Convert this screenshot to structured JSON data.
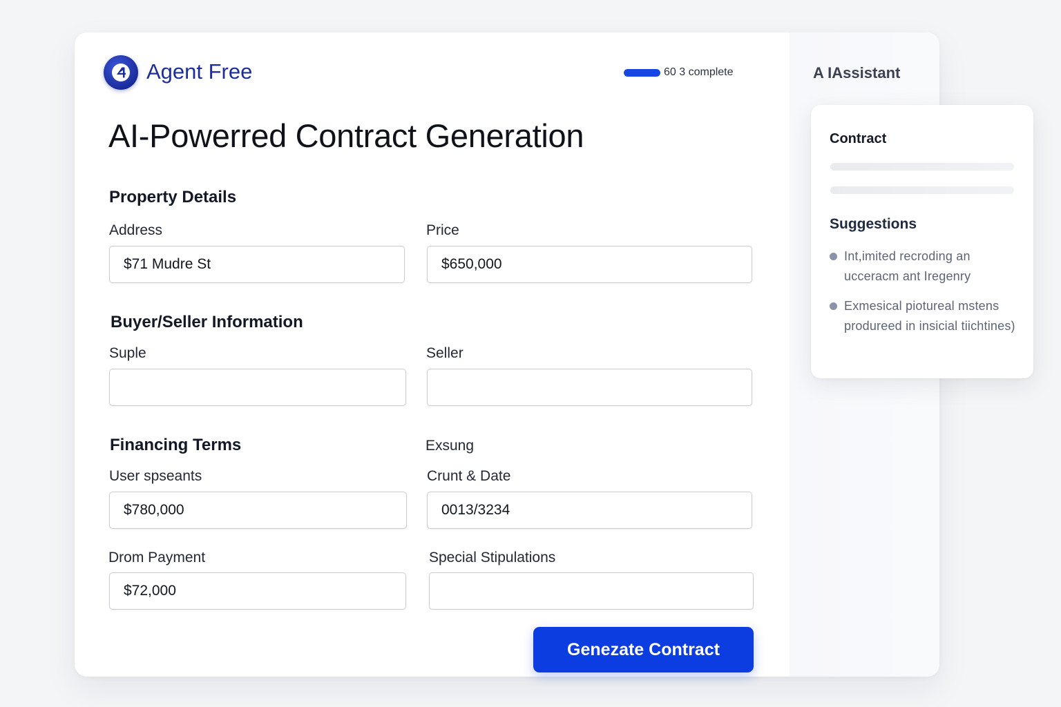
{
  "brand": {
    "logo_glyph": "4",
    "name": "Agent Free",
    "logo_color": "#1e2d9c"
  },
  "progress": {
    "label": "60 3 complete",
    "fraction": 1.0,
    "color": "#1747e3"
  },
  "page_title": "AI-Powerred Contract Generation",
  "sections": {
    "property": {
      "heading": "Property Details",
      "address": {
        "label": "Address",
        "value": "$71 Mudre St"
      },
      "price": {
        "label": "Price",
        "value": "$650,000"
      }
    },
    "parties": {
      "heading": "Buyer/Seller Information",
      "buyer": {
        "label": "Suple",
        "value": ""
      },
      "seller": {
        "label": "Seller",
        "value": ""
      }
    },
    "financing": {
      "heading": "Financing Terms",
      "right_heading": "Exsung",
      "loan": {
        "label": "User spseants",
        "value": "$780,000"
      },
      "closing_date": {
        "label": "Crunt & Date",
        "value": "0013/3234"
      },
      "down_payment": {
        "label": "Drom Payment",
        "value": "$72,000"
      },
      "stipulations": {
        "label": "Special Stipulations",
        "value": ""
      }
    }
  },
  "actions": {
    "generate_label": "Genezate Contract",
    "accent_color": "#0b3de0"
  },
  "assistant": {
    "title": "A IAssistant",
    "card_title": "Contract",
    "suggestions_heading": "Suggestions",
    "suggestions": [
      "Int,imited recroding an ucceracm ant Iregenry",
      "Exmesical piotureal mstens produreed in insicial tiichtines)"
    ]
  }
}
